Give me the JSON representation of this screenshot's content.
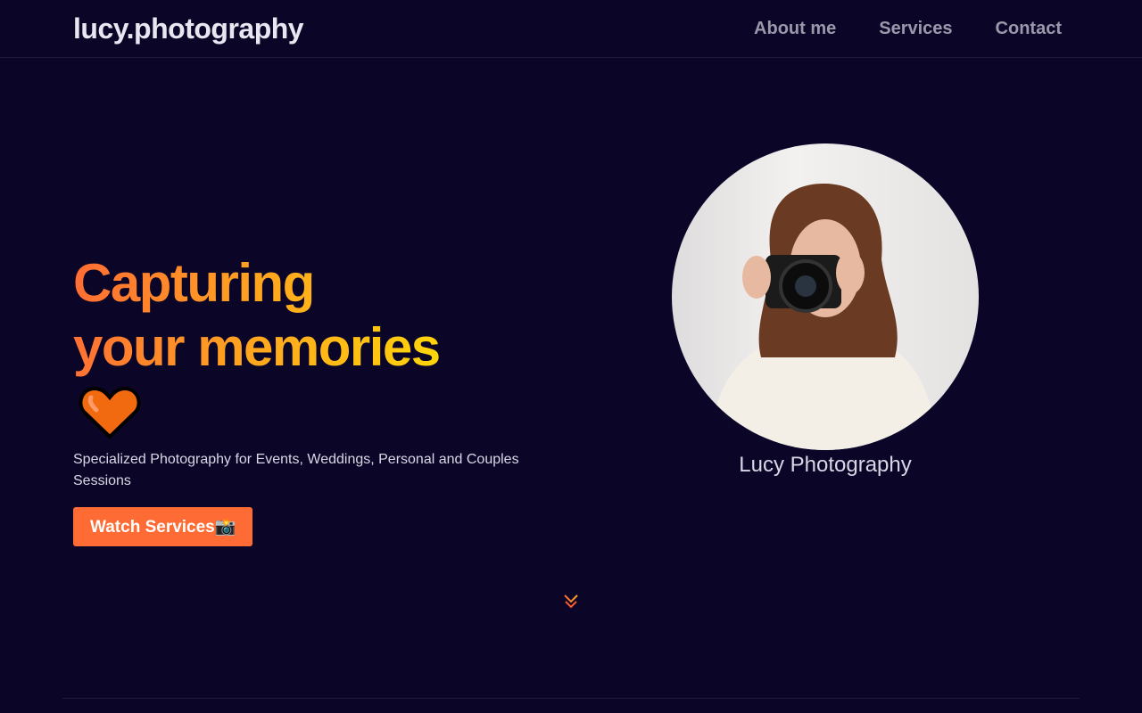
{
  "nav": {
    "logo": "lucy.photography",
    "links": [
      "About me",
      "Services",
      "Contact"
    ]
  },
  "hero": {
    "title_line1": "Capturing",
    "title_line2": "your memories",
    "subtitle": "Specialized Photography for Events, Weddings, Personal and Couples Sessions",
    "button_label": "Watch Services📸",
    "caption": "Lucy Photography"
  },
  "colors": {
    "background": "#0b0628",
    "accent": "#ff6b35",
    "gradient_end": "#ffd60a"
  },
  "icons": {
    "heart": "orange-heart-icon",
    "scroll": "chevron-double-down-icon"
  }
}
